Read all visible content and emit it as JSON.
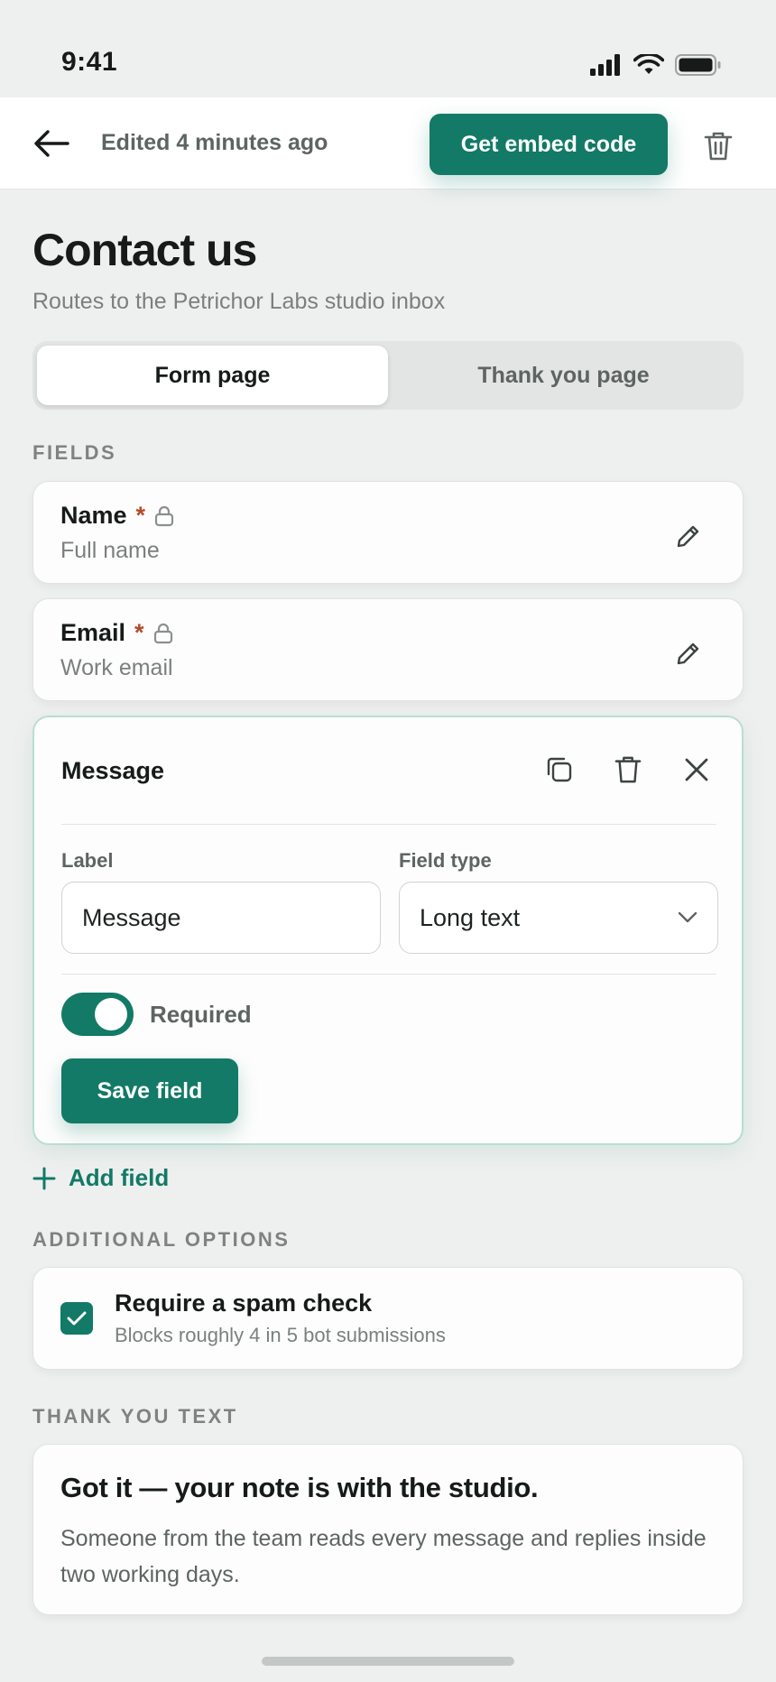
{
  "status_bar": {
    "time": "9:41"
  },
  "topbar": {
    "edited_text": "Edited 4 minutes ago",
    "embed_label": "Get embed code"
  },
  "page": {
    "title": "Contact us",
    "subtitle": "Routes to the Petrichor Labs studio inbox"
  },
  "tabs": [
    {
      "label": "Form page",
      "active": true
    },
    {
      "label": "Thank you page",
      "active": false
    }
  ],
  "fields_section": {
    "label": "FIELDS",
    "fields": [
      {
        "name": "Name",
        "required_mark": "*",
        "description": "Full name"
      },
      {
        "name": "Email",
        "required_mark": "*",
        "description": "Work email"
      }
    ]
  },
  "editor": {
    "title": "Message",
    "label_caption": "Label",
    "label_value": "Message",
    "type_caption": "Field type",
    "type_value": "Long text",
    "required_label": "Required",
    "required_on": true,
    "save_label": "Save field"
  },
  "add_field_label": "Add field",
  "options_section": {
    "label": "ADDITIONAL OPTIONS",
    "spam_title": "Require a spam check",
    "spam_sub": "Blocks roughly 4 in 5 bot submissions",
    "spam_checked": true
  },
  "thank_you_section": {
    "label": "THANK YOU TEXT",
    "heading": "Got it — your note is with the studio.",
    "body": "Someone from the team reads every message and replies inside two working days."
  },
  "colors": {
    "accent": "#127a66",
    "background": "#eef0ef",
    "required": "#b54a2a"
  }
}
